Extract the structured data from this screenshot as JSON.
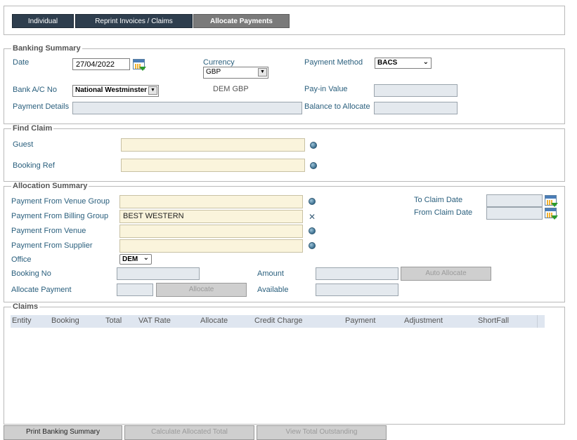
{
  "tabs": [
    {
      "label": "Individual"
    },
    {
      "label": "Reprint Invoices / Claims"
    },
    {
      "label": "Allocate Payments"
    }
  ],
  "banking_summary": {
    "legend": "Banking Summary",
    "date_label": "Date",
    "date_value": "27/04/2022",
    "currency_label": "Currency",
    "currency_value": "GBP",
    "payment_method_label": "Payment Method",
    "payment_method_value": "BACS",
    "bank_label": "Bank A/C No",
    "bank_value": "National Westminster",
    "bank_currency_text": "DEM GBP",
    "payin_label": "Pay-in Value",
    "payin_value": "",
    "payment_details_label": "Payment Details",
    "payment_details_value": "",
    "balance_label": "Balance to Allocate",
    "balance_value": ""
  },
  "find_claim": {
    "legend": "Find Claim",
    "guest_label": "Guest",
    "guest_value": "",
    "booking_ref_label": "Booking Ref",
    "booking_ref_value": ""
  },
  "allocation_summary": {
    "legend": "Allocation Summary",
    "venue_group_label": "Payment From Venue Group",
    "venue_group_value": "",
    "billing_group_label": "Payment From Billing Group",
    "billing_group_value": "BEST WESTERN",
    "venue_label": "Payment From Venue",
    "venue_value": "",
    "supplier_label": "Payment From Supplier",
    "supplier_value": "",
    "office_label": "Office",
    "office_value": "DEM",
    "booking_no_label": "Booking No",
    "booking_no_value": "",
    "allocate_payment_label": "Allocate Payment",
    "allocate_payment_value": "",
    "allocate_button": "Allocate",
    "amount_label": "Amount",
    "amount_value": "",
    "available_label": "Available",
    "available_value": "",
    "auto_allocate_button": "Auto Allocate",
    "to_claim_date_label": "To Claim Date",
    "to_claim_date_value": "",
    "from_claim_date_label": "From Claim Date",
    "from_claim_date_value": ""
  },
  "claims": {
    "legend": "Claims",
    "columns": [
      "Entity",
      "Booking",
      "Total",
      "VAT Rate",
      "Allocate",
      "Credit Charge",
      "Payment",
      "Adjustment",
      "ShortFall"
    ],
    "rows": []
  },
  "footer_buttons": {
    "print": "Print Banking Summary",
    "calculate": "Calculate Allocated Total",
    "view_outstanding": "View Total Outstanding"
  },
  "colors": {
    "tab_dark": "#2e3e4e",
    "tab_active": "#7a7a7a",
    "label_blue": "#2a5f7d",
    "cream_field": "#faf4dc",
    "grey_field": "#e4e9ee",
    "grid_header": "#dfe6f0"
  },
  "icons": [
    "calendar-icon",
    "globe-icon",
    "clear-icon",
    "dropdown-arrow-icon"
  ]
}
